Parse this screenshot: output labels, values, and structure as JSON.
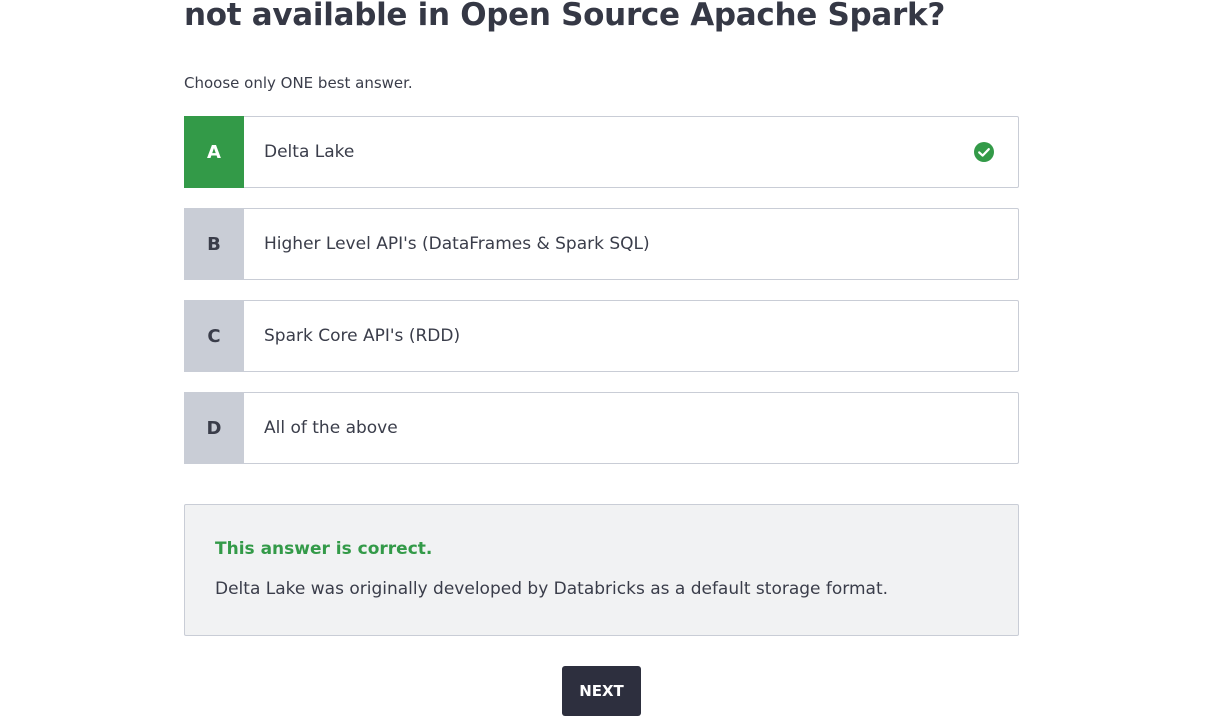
{
  "question": {
    "title_visible": "not available in Open Source Apache Spark?",
    "instructions": "Choose only ONE best answer."
  },
  "options": [
    {
      "letter": "A",
      "text": "Delta Lake",
      "state": "correct-selected"
    },
    {
      "letter": "B",
      "text": "Higher Level API's (DataFrames & Spark SQL)",
      "state": "unselected"
    },
    {
      "letter": "C",
      "text": "Spark Core API's (RDD)",
      "state": "unselected"
    },
    {
      "letter": "D",
      "text": "All of the above",
      "state": "unselected"
    }
  ],
  "feedback": {
    "title": "This answer is correct.",
    "body": "Delta Lake was originally developed by Databricks as a default storage format."
  },
  "actions": {
    "next_label": "NEXT"
  },
  "icons": {
    "correct": "check-circle-icon"
  },
  "colors": {
    "correct_green": "#339a48",
    "option_letter_bg": "#c9cdd6",
    "button_dark": "#2d2f3e",
    "feedback_bg": "#f1f2f3",
    "text_dark": "#3a3d4a"
  }
}
